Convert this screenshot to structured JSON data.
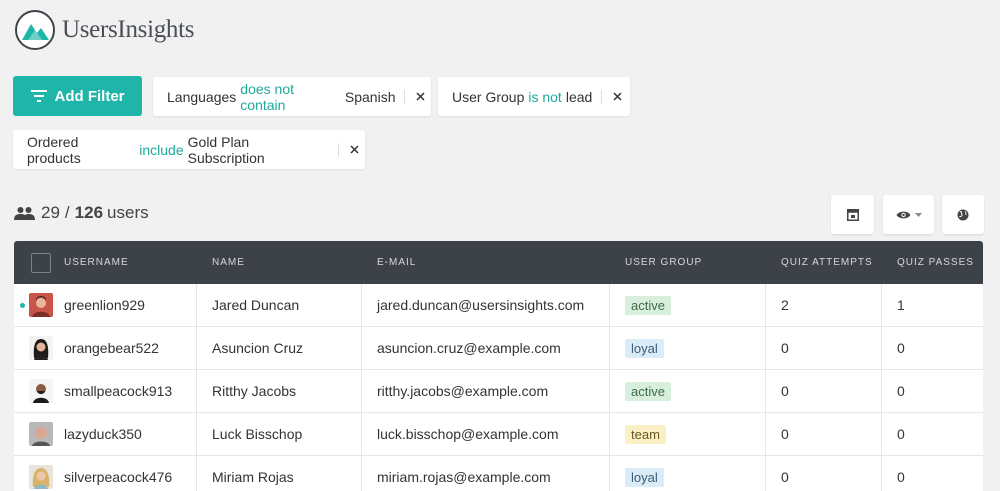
{
  "app": {
    "name": "UsersInsights"
  },
  "toolbar": {
    "add_filter_label": "Add Filter"
  },
  "filters": [
    {
      "field": "Languages",
      "operator": "does not contain",
      "value": "Spanish"
    },
    {
      "field": "User Group",
      "operator": "is not",
      "value": "lead"
    },
    {
      "field": "Ordered products",
      "operator": "include",
      "value": "Gold Plan Subscription"
    }
  ],
  "user_count": {
    "shown": "29",
    "separator": "/",
    "total": "126",
    "suffix": "users"
  },
  "table": {
    "columns": [
      "USERNAME",
      "NAME",
      "E-MAIL",
      "USER GROUP",
      "QUIZ ATTEMPTS",
      "QUIZ PASSES"
    ],
    "rows": [
      {
        "username": "greenlion929",
        "name": "Jared Duncan",
        "email": "jared.duncan@usersinsights.com",
        "group": "active",
        "attempts": "2",
        "passes": "1"
      },
      {
        "username": "orangebear522",
        "name": "Asuncion Cruz",
        "email": "asuncion.cruz@example.com",
        "group": "loyal",
        "attempts": "0",
        "passes": "0"
      },
      {
        "username": "smallpeacock913",
        "name": "Ritthy Jacobs",
        "email": "ritthy.jacobs@example.com",
        "group": "active",
        "attempts": "0",
        "passes": "0"
      },
      {
        "username": "lazyduck350",
        "name": "Luck Bisschop",
        "email": "luck.bisschop@example.com",
        "group": "team",
        "attempts": "0",
        "passes": "0"
      },
      {
        "username": "silverpeacock476",
        "name": "Miriam Rojas",
        "email": "miriam.rojas@example.com",
        "group": "loyal",
        "attempts": "0",
        "passes": "0"
      }
    ]
  },
  "colors": {
    "accent": "#1fb5a8",
    "header_bg": "#3d4249",
    "page_bg": "#f1f1f1"
  }
}
